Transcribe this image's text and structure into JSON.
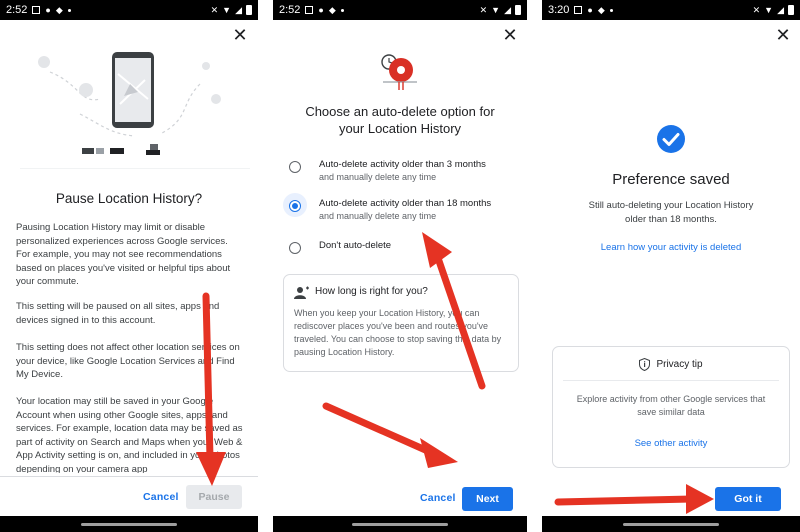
{
  "panel1": {
    "status": {
      "time": "2:52"
    },
    "title": "Pause Location History?",
    "paragraphs": [
      "Pausing Location History may limit or disable personalized experiences across Google services. For example, you may not see recommendations based on places you've visited or helpful tips about your commute.",
      "This setting will be paused on all sites, apps and devices signed in to this account.",
      "This setting does not affect other location services on your device, like Google Location Services and Find My Device.",
      "Your location may still be saved in your Google Account when using other Google sites, apps, and services. For example, location data may be saved as part of activity on Search and Maps when your Web & App Activity setting is on, and included in your photos depending on your camera app"
    ],
    "cancel_label": "Cancel",
    "pause_label": "Pause"
  },
  "panel2": {
    "status": {
      "time": "2:52"
    },
    "title_line1": "Choose an auto-delete option for",
    "title_line2": "your Location History",
    "options": [
      {
        "main": "Auto-delete activity older than 3 months",
        "sub": "and manually delete any time",
        "selected": false
      },
      {
        "main": "Auto-delete activity older than 18 months",
        "sub": "and manually delete any time",
        "selected": true
      },
      {
        "main": "Don't auto-delete",
        "sub": "",
        "selected": false
      }
    ],
    "tip_heading": "How long is right for you?",
    "tip_body": "When you keep your Location History, you can rediscover places you've been and routes you've traveled. You can choose to stop saving this data by pausing Location History.",
    "cancel_label": "Cancel",
    "next_label": "Next"
  },
  "panel3": {
    "status": {
      "time": "3:20"
    },
    "title": "Preference saved",
    "body_line1": "Still auto-deleting your Location History",
    "body_line2": "older than 18 months.",
    "learn_link": "Learn how your activity is deleted",
    "privacy_tip_heading": "Privacy tip",
    "privacy_tip_body_line1": "Explore activity from other Google services that",
    "privacy_tip_body_line2": "save similar data",
    "see_other_link": "See other activity",
    "got_it_label": "Got it"
  },
  "colors": {
    "accent": "#1a73e8",
    "arrow": "#e53323",
    "disabled_button": "#e8eaed",
    "check_circle": "#1a73e8"
  }
}
